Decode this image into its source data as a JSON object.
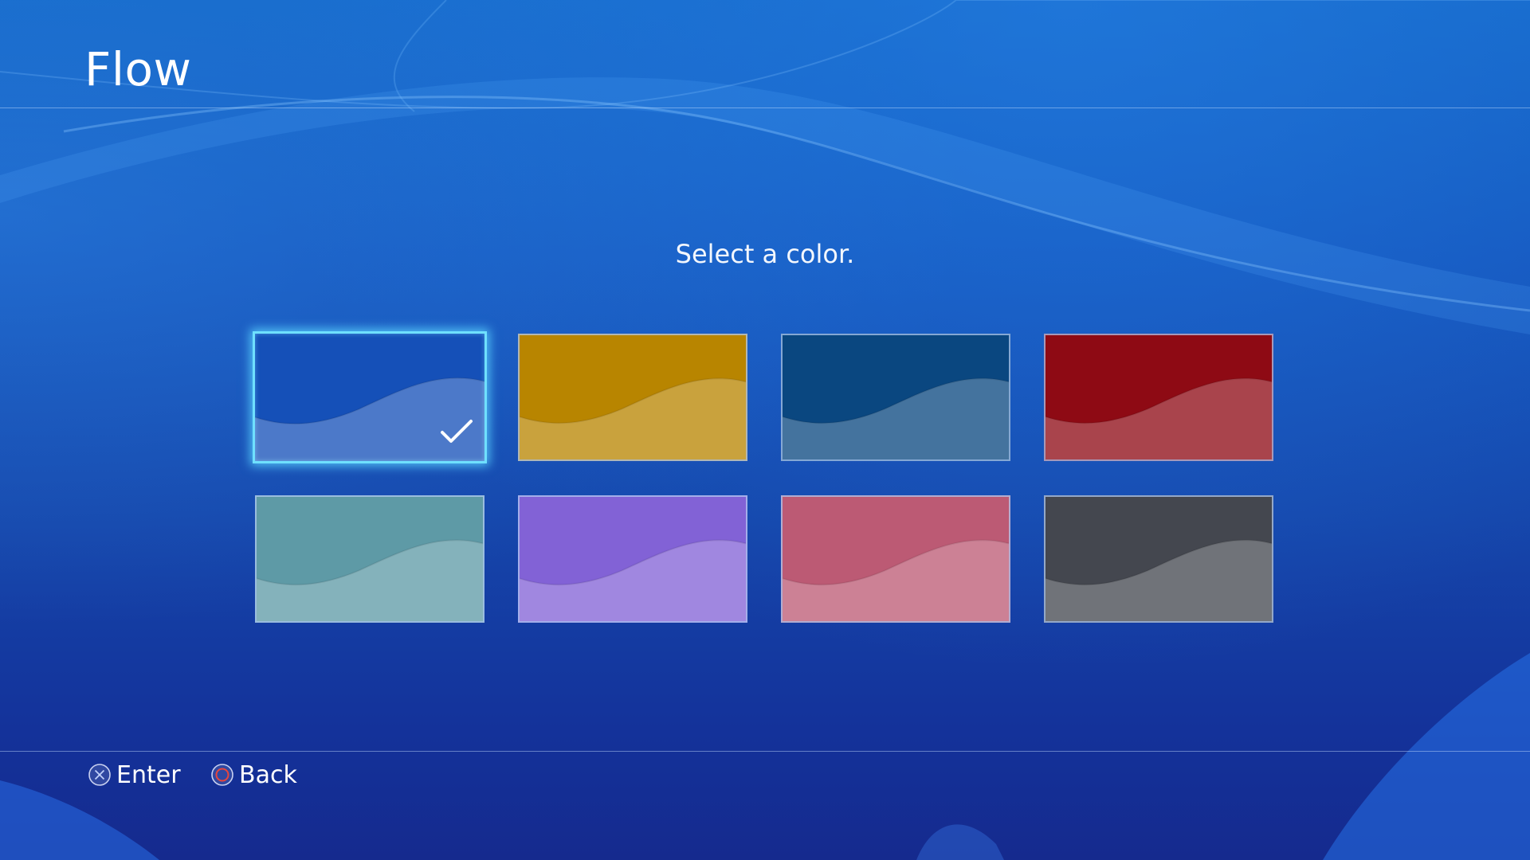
{
  "header": {
    "title": "Flow"
  },
  "main": {
    "prompt": "Select a color."
  },
  "colors": [
    {
      "name": "blue",
      "base": "#1550b8",
      "selected": true
    },
    {
      "name": "gold",
      "base": "#b88500",
      "selected": false
    },
    {
      "name": "navy",
      "base": "#0a4780",
      "selected": false
    },
    {
      "name": "red",
      "base": "#8e0a14",
      "selected": false
    },
    {
      "name": "teal",
      "base": "#5e9aa6",
      "selected": false
    },
    {
      "name": "purple",
      "base": "#8262d6",
      "selected": false
    },
    {
      "name": "pink",
      "base": "#bc5a74",
      "selected": false
    },
    {
      "name": "gray",
      "base": "#44474f",
      "selected": false
    }
  ],
  "footer": {
    "enter_label": "Enter",
    "back_label": "Back",
    "enter_icon": "cross-button-icon",
    "back_icon": "circle-button-icon",
    "circle_icon_color": "#e8453c"
  }
}
